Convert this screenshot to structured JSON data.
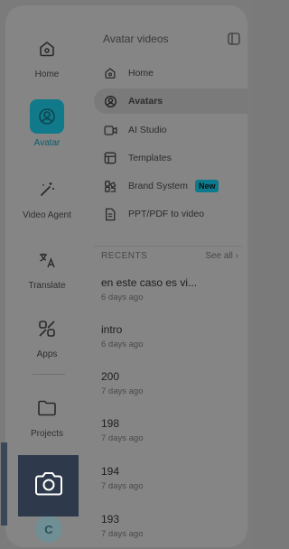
{
  "rail": {
    "home": "Home",
    "avatar": "Avatar",
    "video_agent": "Video Agent",
    "translate": "Translate",
    "apps": "Apps",
    "projects": "Projects"
  },
  "nav": {
    "title": "Avatar videos",
    "items": [
      {
        "label": "Home",
        "icon": "home-icon"
      },
      {
        "label": "Avatars",
        "icon": "avatar-circle-icon"
      },
      {
        "label": "AI Studio",
        "icon": "video-camera-icon"
      },
      {
        "label": "Templates",
        "icon": "templates-icon"
      },
      {
        "label": "Brand System",
        "icon": "brand-icon",
        "badge": "New"
      },
      {
        "label": "PPT/PDF to video",
        "icon": "document-icon"
      }
    ],
    "recents_label": "RECENTS",
    "see_all": "See all ›"
  },
  "recents": [
    {
      "title": "en este caso es vi...",
      "time": "6 days ago"
    },
    {
      "title": "intro",
      "time": "6 days ago"
    },
    {
      "title": "200",
      "time": "7 days ago"
    },
    {
      "title": "198",
      "time": "7 days ago"
    },
    {
      "title": "194",
      "time": "7 days ago"
    },
    {
      "title": "193",
      "time": "7 days ago"
    }
  ],
  "user": {
    "initial": "C"
  },
  "colors": {
    "accent": "#107a8a",
    "badge": "#0b7a8c",
    "camera_overlay": "#2e3a4b"
  }
}
